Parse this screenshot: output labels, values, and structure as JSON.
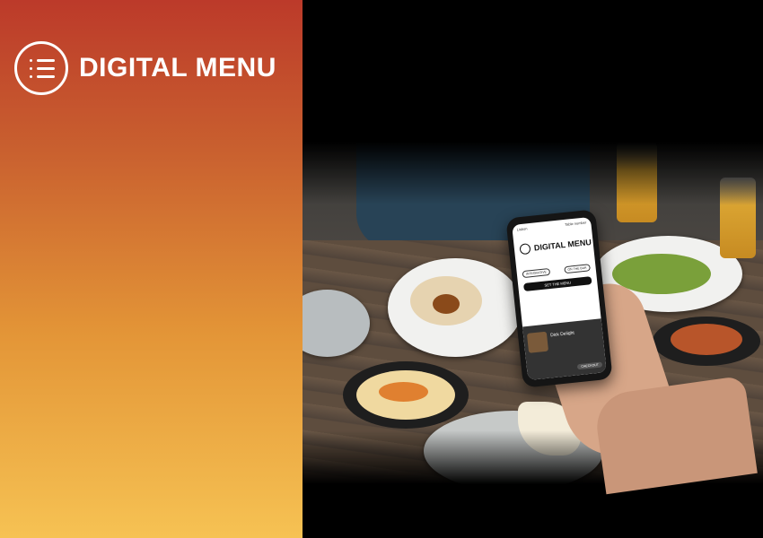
{
  "brand": {
    "title": "DIGITAL MENU",
    "icon": "menu-list-icon"
  },
  "phone_screen": {
    "status_left": "Lisbon",
    "status_right": "Table number",
    "status_left_sub": "",
    "status_right_sub": "",
    "title": "DIGITAL MENU",
    "button_left": "INTEGRATIVE",
    "button_right": "ON THE BAR",
    "cta": "SET THE MENU",
    "card_title": "Dick Delight",
    "card_sub": "",
    "checkout": "CHECKOUT"
  },
  "colors": {
    "gradient_top": "#bc3a2a",
    "gradient_bottom": "#f6c253"
  }
}
